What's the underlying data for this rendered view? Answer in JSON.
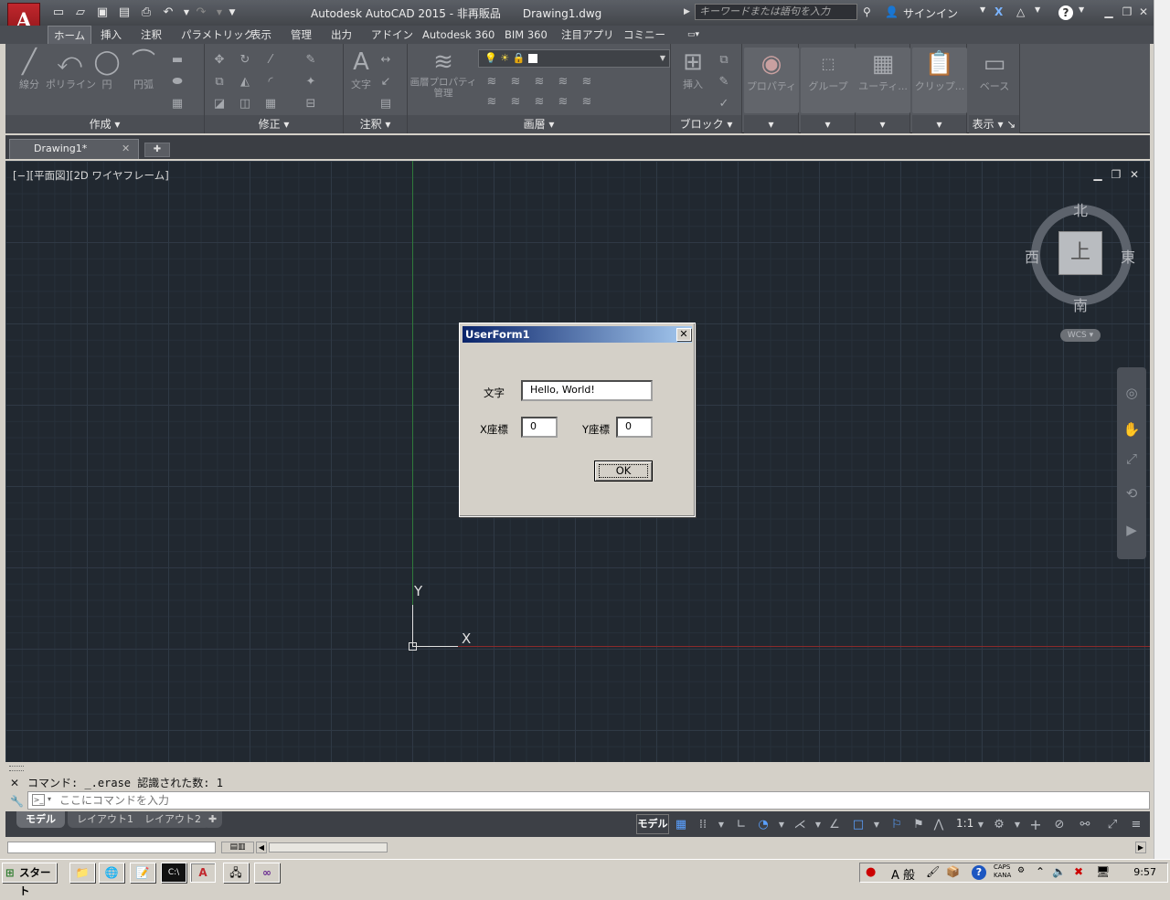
{
  "titlebar": {
    "title": "Autodesk AutoCAD 2015 - 非再販品　　Drawing1.dwg",
    "search_placeholder": "キーワードまたは語句を入力",
    "signin": "サインイン",
    "app_letter": "A"
  },
  "ribbon_tabs": [
    "ホーム",
    "挿入",
    "注釈",
    "パラメトリック",
    "表示",
    "管理",
    "出力",
    "アドイン",
    "Autodesk 360",
    "BIM 360",
    "注目アプリ",
    "コミニー"
  ],
  "panels": {
    "draw": {
      "title": "作成",
      "tools": [
        "線分",
        "ポリライン",
        "円",
        "円弧"
      ]
    },
    "modify": {
      "title": "修正"
    },
    "annotation": {
      "title": "注釈",
      "text_tool": "文字"
    },
    "layers": {
      "title": "画層",
      "properties_tool": "画層プロパティ\n管理"
    },
    "block": {
      "title": "ブロック",
      "insert_tool": "挿入"
    },
    "properties": {
      "title": "プロパティ"
    },
    "groups": {
      "title": "グループ"
    },
    "utilities": {
      "title": "ユーティ..."
    },
    "clipboard": {
      "title": "クリップ..."
    },
    "base": {
      "title": "ベース"
    },
    "view": {
      "title": "表示"
    }
  },
  "doc_tabs": {
    "active": "Drawing1*"
  },
  "viewport": {
    "label": "[−][平面図][2D ワイヤフレーム]",
    "compass": {
      "north": "北",
      "south": "南",
      "east": "東",
      "west": "西",
      "top": "上",
      "wcs": "WCS"
    },
    "ucs": {
      "x": "X",
      "y": "Y"
    }
  },
  "dialog": {
    "title": "UserForm1",
    "text_label": "文字",
    "text_value": "Hello, World!",
    "x_label": "X座標",
    "x_value": "0",
    "y_label": "Y座標",
    "y_value": "0",
    "ok_label": "OK"
  },
  "command": {
    "history": "コマンド: _.erase 認識された数: 1",
    "placeholder": "ここにコマンドを入力"
  },
  "layout_tabs": [
    "モデル",
    "レイアウト1",
    "レイアウト2"
  ],
  "statusbar": {
    "model_label": "モデル",
    "scale": "1:1"
  },
  "taskbar": {
    "start": "スタート",
    "ime_mode": "A 般",
    "caps": "CAPS",
    "kana": "KANA",
    "clock": "9:57"
  }
}
